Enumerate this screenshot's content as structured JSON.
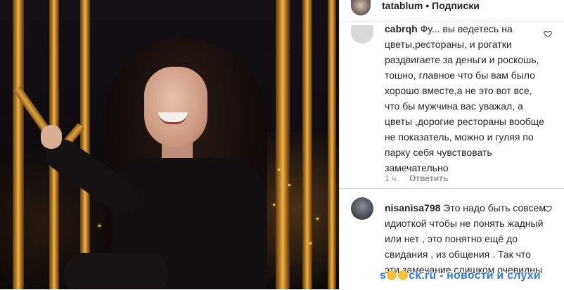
{
  "header": {
    "username": "tatablum",
    "separator": "•",
    "follow_label": "Подписки"
  },
  "comments": [
    {
      "username": "cabrqh",
      "text": "Фу... вы ведетесь на цветы,рестораны, и рогатки раздвигаете за деньги и роскошь, тошно, главное что бы вам было хорошо вместе,а не это вот все, что бы мужчина вас уважал, а цветы ,дорогие рестораны вообще не показатель, можно и гуляя по парку себя чувствовать замечательно",
      "time": "1 ч.",
      "reply_label": "Ответить"
    },
    {
      "username": "nisanisa798",
      "text": "Это надо быть совсем идиоткой чтобы не понять жадный или нет , это понятно ещё до свидания , из общения . Так что эти замечание слишком очевидны"
    }
  ],
  "watermark": {
    "prefix": "s",
    "middle": "ck.ru - новости и слухи"
  },
  "icons": {
    "like": "heart-outline-icon"
  },
  "colors": {
    "watermark": "#2e7bd6",
    "muted": "#8e8e8e",
    "text": "#262626"
  }
}
